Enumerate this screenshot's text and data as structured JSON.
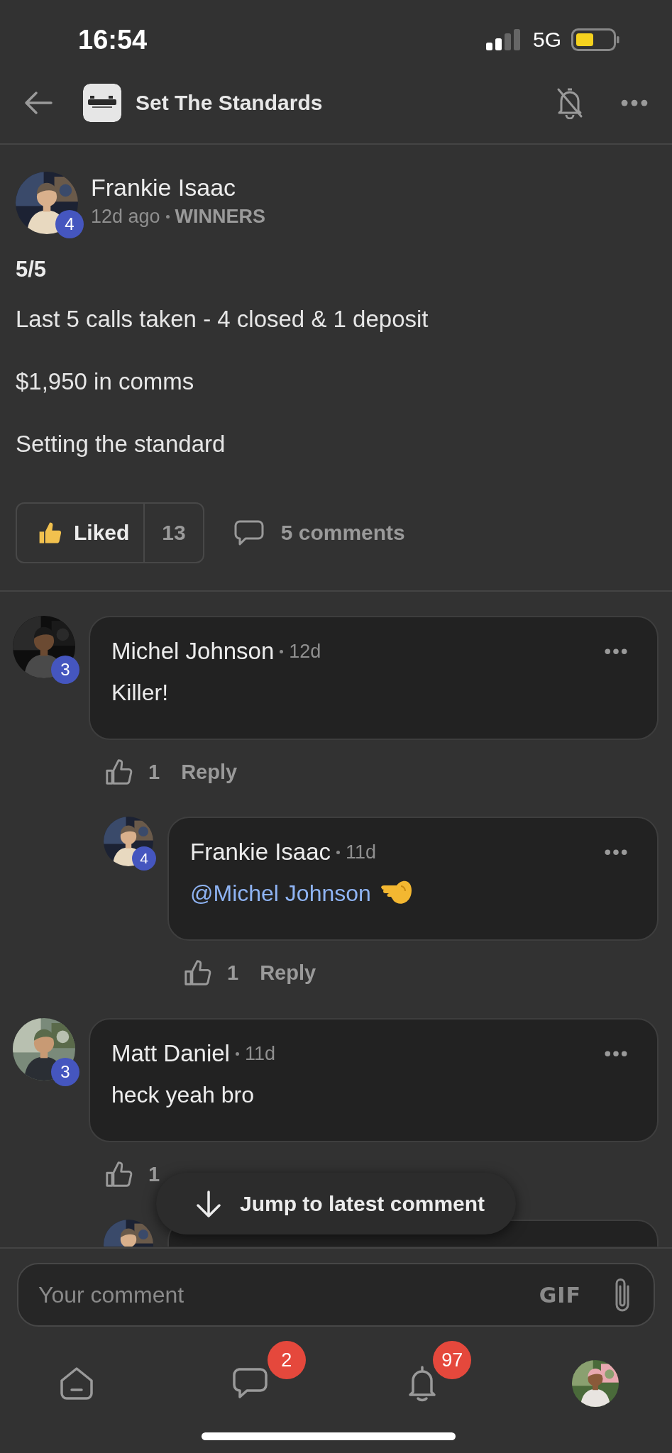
{
  "status_bar": {
    "time": "16:54",
    "network": "5G"
  },
  "header": {
    "group_name": "Set The Standards"
  },
  "post": {
    "author": "Frankie Isaac",
    "level": "4",
    "time": "12d ago",
    "category": "WINNERS",
    "title": "5/5",
    "paragraphs": [
      "Last 5 calls taken - 4 closed & 1 deposit",
      "$1,950 in comms",
      "Setting the standard"
    ],
    "like_button": {
      "label": "Liked",
      "liked": true,
      "count": "13"
    },
    "comments_link": "5 comments"
  },
  "comments": [
    {
      "author": "Michel Johnson",
      "level": "3",
      "time": "12d",
      "text": "Killer!",
      "liked": false,
      "likes": "1",
      "reply": "Reply",
      "replies": [
        {
          "kind": "reply",
          "author": "Frankie Isaac",
          "level": "4",
          "time": "11d",
          "mention": "@Michel Johnson",
          "liked": false,
          "likes": "1",
          "reply": "Reply"
        }
      ]
    },
    {
      "author": "Matt Daniel",
      "level": "3",
      "time": "11d",
      "text": "heck yeah bro",
      "liked": false,
      "likes": "1",
      "replies": [
        {
          "kind": "cut_off"
        }
      ]
    }
  ],
  "jump_button": "Jump to latest comment",
  "comment_box": {
    "placeholder": "Your comment",
    "gif": "GIF"
  },
  "nav": [
    {
      "kind": "home"
    },
    {
      "kind": "chat",
      "badge": "2"
    },
    {
      "kind": "bell",
      "badge": "97"
    },
    {
      "kind": "profile"
    }
  ]
}
